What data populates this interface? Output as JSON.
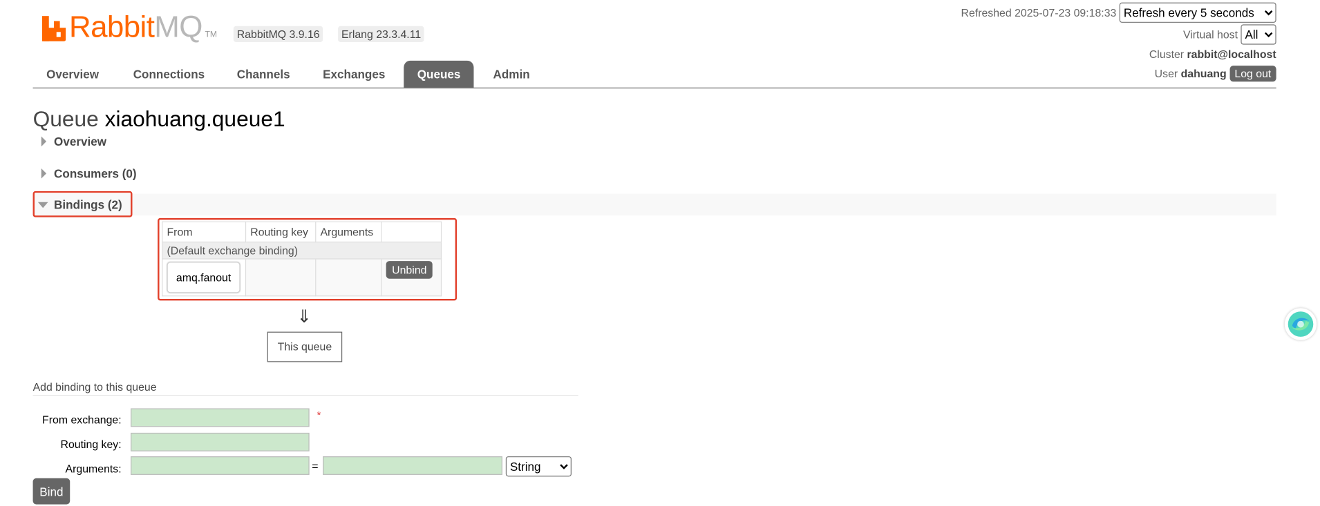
{
  "header": {
    "brand_primary": "Rabbit",
    "brand_secondary": "MQ",
    "trademark": "TM",
    "version_badge": "RabbitMQ 3.9.16",
    "erlang_badge": "Erlang 23.3.4.11",
    "refreshed_label": "Refreshed 2025-07-23 09:18:33",
    "refresh_select": "Refresh every 5 seconds",
    "vhost_label": "Virtual host",
    "vhost_select": "All",
    "cluster_label": "Cluster",
    "cluster_value": "rabbit@localhost",
    "user_label": "User",
    "user_value": "dahuang",
    "logout_label": "Log out"
  },
  "nav": {
    "tabs": [
      {
        "label": "Overview"
      },
      {
        "label": "Connections"
      },
      {
        "label": "Channels"
      },
      {
        "label": "Exchanges"
      },
      {
        "label": "Queues",
        "active": true
      },
      {
        "label": "Admin"
      }
    ]
  },
  "page": {
    "title_prefix": "Queue",
    "queue_name": "xiaohuang.queue1"
  },
  "sections": {
    "overview": "Overview",
    "consumers": "Consumers (0)",
    "bindings": "Bindings (2)"
  },
  "bindings_table": {
    "columns": [
      "From",
      "Routing key",
      "Arguments",
      ""
    ],
    "default_row": "(Default exchange binding)",
    "rows": [
      {
        "from": "amq.fanout",
        "routing_key": "",
        "arguments": "",
        "action": "Unbind"
      }
    ]
  },
  "flow": {
    "arrow": "⇓",
    "target": "This queue"
  },
  "add_binding": {
    "heading": "Add binding to this queue",
    "from_label": "From exchange:",
    "routing_label": "Routing key:",
    "arguments_label": "Arguments:",
    "required_mark": "*",
    "equals": "=",
    "type_select": "String",
    "bind_label": "Bind"
  },
  "colors": {
    "brand_orange": "#ff6600",
    "nav_active": "#666666",
    "highlight": "#e2402b",
    "input_green": "#cce8cc"
  }
}
